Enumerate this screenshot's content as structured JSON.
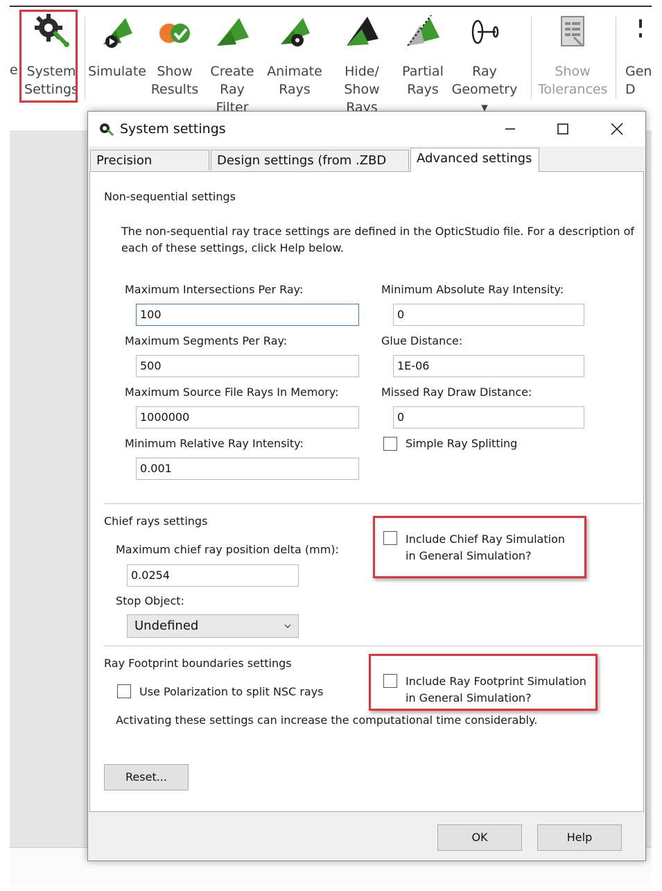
{
  "ribbon": {
    "partial_left": "e",
    "buttons": [
      {
        "label": "System\nSettings",
        "icon": "gear-wrench-icon"
      },
      {
        "label": "Simulate",
        "icon": "simulate-icon"
      },
      {
        "label": "Show\nResults",
        "icon": "show-results-icon"
      },
      {
        "label": "Create\nRay Filter",
        "icon": "ray-filter-icon"
      },
      {
        "label": "Animate\nRays",
        "icon": "animate-rays-icon"
      },
      {
        "label": "Hide/\nShow Rays",
        "icon": "hide-show-rays-icon"
      },
      {
        "label": "Partial\nRays",
        "icon": "partial-rays-icon"
      },
      {
        "label": "Ray\nGeometry ▾",
        "icon": "ray-geometry-icon"
      },
      {
        "label": "Show\nTolerances",
        "icon": "tolerances-icon",
        "disabled": true
      },
      {
        "label": "Gen\nD",
        "icon": "generic-icon"
      }
    ]
  },
  "dialog": {
    "title": "System settings",
    "tabs": [
      "Precision settings",
      "Design settings (from .ZBD file)",
      "Advanced settings"
    ],
    "active_tab": "Advanced settings",
    "nonseq": {
      "heading": "Non-sequential settings",
      "description": "The non-sequential ray trace settings are defined in the OpticStudio file. For a description of\neach of these settings, click Help below.",
      "max_intersections_label": "Maximum Intersections Per Ray:",
      "max_intersections_value": "100",
      "max_segments_label": "Maximum Segments Per Ray:",
      "max_segments_value": "500",
      "max_source_rays_label": "Maximum Source File Rays In Memory:",
      "max_source_rays_value": "1000000",
      "min_relative_label": "Minimum Relative Ray Intensity:",
      "min_relative_value": "0.001",
      "min_absolute_label": "Minimum Absolute Ray Intensity:",
      "min_absolute_value": "0",
      "glue_label": "Glue Distance:",
      "glue_value": "1E-06",
      "missed_label": "Missed Ray Draw Distance:",
      "missed_value": "0",
      "simple_split_label": "Simple Ray Splitting"
    },
    "chief": {
      "heading": "Chief rays settings",
      "delta_label": "Maximum chief ray position delta (mm):",
      "delta_value": "0.0254",
      "stop_label": "Stop Object:",
      "stop_value": "Undefined",
      "include_label": "Include Chief Ray Simulation\nin General Simulation?"
    },
    "footprint": {
      "heading": "Ray Footprint boundaries settings",
      "polarization_label": "Use Polarization to split NSC rays",
      "include_label": "Include Ray Footprint Simulation\nin General Simulation?",
      "note": "Activating these settings can increase the computational time considerably."
    },
    "reset_label": "Reset...",
    "ok_label": "OK",
    "help_label": "Help"
  },
  "colors": {
    "highlight": "#e2323a",
    "icon_green": "#3f9a2e",
    "icon_orange": "#f0782a"
  }
}
